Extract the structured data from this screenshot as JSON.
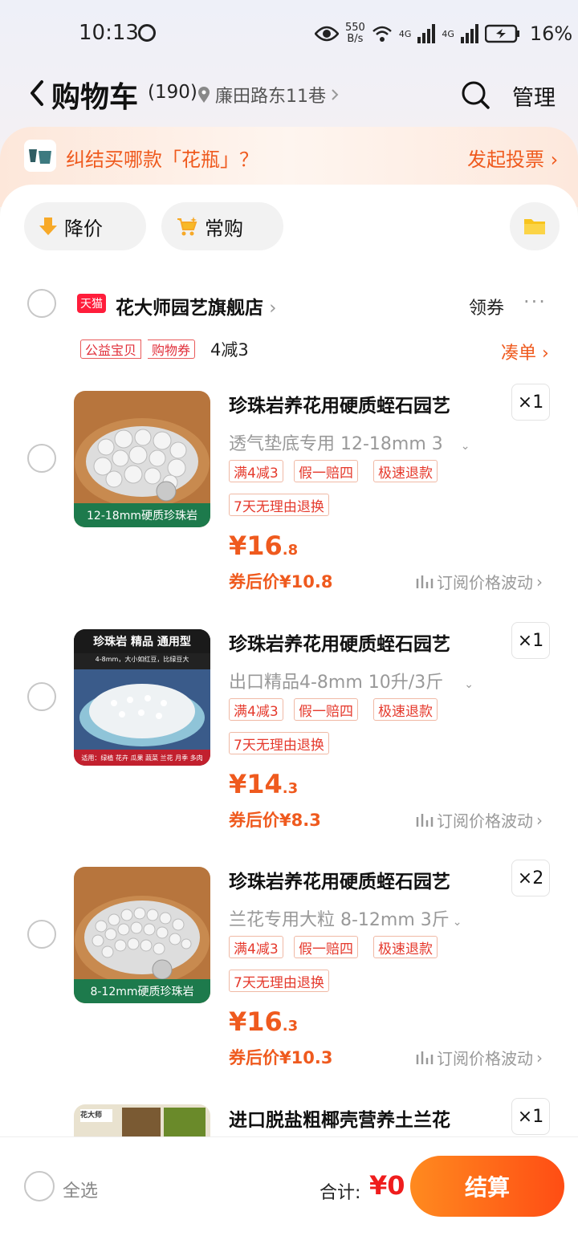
{
  "status": {
    "time": "10:13",
    "net_speed_value": "550",
    "net_speed_unit": "B/s",
    "signal1": "4G",
    "signal2": "4G",
    "battery": "16%"
  },
  "header": {
    "title": "购物车",
    "count": "(190)",
    "location": "廉田路东11巷",
    "manage": "管理"
  },
  "banner": {
    "text": "纠结买哪款「花瓶」？",
    "action": "发起投票"
  },
  "chips": {
    "price_drop": "降价",
    "frequent": "常购"
  },
  "store": {
    "badge": "天猫",
    "name": "花大师园艺旗舰店",
    "coupon": "领券",
    "more": "···",
    "tags": [
      "公益宝贝",
      "购物券"
    ],
    "promo": "4减3",
    "coudan": "凑单"
  },
  "items": [
    {
      "title": "珍珠岩养花用硬质蛭石园艺",
      "qty": "×1",
      "sku": "透气垫底专用 12-18mm 3",
      "tags": [
        "满4减3",
        "假一赔四",
        "极速退款"
      ],
      "tag2": "7天无理由退换",
      "price_int": "¥16",
      "price_dec": ".8",
      "after_price": "券后价¥10.8",
      "watch": "订阅价格波动",
      "caption": "12-18mm硬质珍珠岩"
    },
    {
      "title": "珍珠岩养花用硬质蛭石园艺",
      "qty": "×1",
      "sku": "出口精品4-8mm 10升/3斤",
      "tags": [
        "满4减3",
        "假一赔四",
        "极速退款"
      ],
      "tag2": "7天无理由退换",
      "price_int": "¥14",
      "price_dec": ".3",
      "after_price": "券后价¥8.3",
      "watch": "订阅价格波动",
      "caption_top": "珍珠岩 精品 通用型",
      "caption_sub": "4-8mm，大小如红豆，比绿豆大",
      "caption_bottom": "适用：绿植 花卉 瓜果 蔬菜 兰花 月季 多肉"
    },
    {
      "title": "珍珠岩养花用硬质蛭石园艺",
      "qty": "×2",
      "sku": "兰花专用大粒 8-12mm 3斤",
      "tags": [
        "满4减3",
        "假一赔四",
        "极速退款"
      ],
      "tag2": "7天无理由退换",
      "price_int": "¥16",
      "price_dec": ".3",
      "after_price": "券后价¥10.3",
      "watch": "订阅价格波动",
      "caption": "8-12mm硬质珍珠岩"
    },
    {
      "title": "进口脱盐粗椰壳营养土兰花",
      "qty": "×1"
    }
  ],
  "bottom": {
    "select_all": "全选",
    "total_label": "合计:",
    "total": "¥0",
    "checkout": "结算"
  },
  "colors": {
    "accent": "#ef5a1e",
    "checkout_start": "#ff8a1f",
    "checkout_end": "#ff4d14",
    "tmall": "#ff1d3b"
  }
}
